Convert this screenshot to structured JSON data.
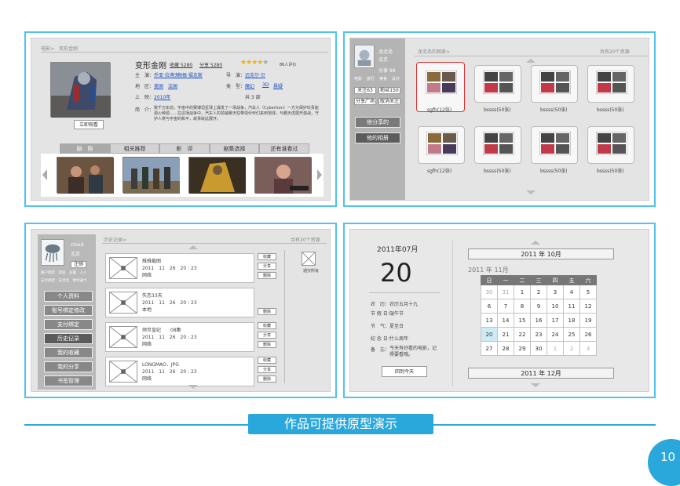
{
  "p1": {
    "breadcrumb": "电影>　变形金刚",
    "title": "变形金刚",
    "collect": "收藏 5280",
    "share": "分享 5280",
    "rating": "86人评价",
    "director_label": "主　演：",
    "director": "乔亚·拉博夫",
    "director2": "梅根·福克斯",
    "guide_label": "导　演：",
    "guide": "迈克尔·贝",
    "region_label": "地　区：",
    "region1": "美国",
    "region2": "法国",
    "type_label": "类　型：",
    "type1": "魔幻",
    "type2": "3D",
    "type3": "悬疑",
    "year_label": "上　映：",
    "year": "2010年",
    "episodes": "共 3 部",
    "summary_label": "简　介：",
    "summary": "数千万年前，宇宙中的赛博坦星球上爆发了一场战争，汽车人（Cybertron）一方为保护珍贵能源火种源……在这场战争中，汽车人的领袖擎天柱带领伙伴们来到地球，与霸天虎展开激战，守护人类与宇宙的和平，故事就此展开。",
    "watch_btn": "立即观看",
    "tabs": [
      "剧　照",
      "相关推荐",
      "影　评",
      "剧集选择",
      "还有谁看过"
    ]
  },
  "p2": {
    "name": "龙北岛",
    "city": "北京",
    "meta": "分享 98",
    "tags": [
      "电影",
      "旅行",
      "美食",
      "设计"
    ],
    "follow": "关注63",
    "fans": "粉丝150",
    "share_album": "分享广场",
    "cancel": "取消关注",
    "btn1": "他分享的",
    "btn2": "他的相册",
    "breadcrumb": "龙北岛的相册>",
    "count": "共有20个资源",
    "albums": [
      "sgfh(12张)",
      "bssss(50张)",
      "bssss(50张)",
      "bssss(50张)",
      "sgfh(12张)",
      "bssss(50张)",
      "bssss(50张)",
      "bssss(50张)"
    ]
  },
  "p3": {
    "name": "cloud",
    "city": "北京",
    "logout": "注销",
    "links": "账户绑定：新浪　豆瓣　人人",
    "links2": "支付绑定：支付宝　财付通卡",
    "breadcrumb": "历史记录>",
    "count": "共有20个资源",
    "menu": [
      "个人资料",
      "账号绑定修改",
      "支付绑定",
      "历史记录",
      "我的收藏",
      "我的分享",
      "书签管理"
    ],
    "items": [
      {
        "title": "蛛蛛截图",
        "date": "2011　11　26　20 : 23",
        "src": "网络",
        "btns": [
          "收藏",
          "分享",
          "删除"
        ]
      },
      {
        "title": "失恋33天",
        "date": "2011　11　26　20 : 23",
        "src": "本地",
        "btns": [
          "删除"
        ]
      },
      {
        "title": "倾世皇妃　　08集",
        "date": "2011　11　26　20 : 23",
        "src": "网络",
        "btns": [
          "收藏",
          "分享",
          "删除"
        ]
      },
      {
        "title": "LONGMAO．JPG",
        "date": "2011　11　26　20 : 23",
        "src": "网络",
        "btns": [
          "收藏",
          "分享",
          "删除"
        ]
      }
    ],
    "empty": "通交所有"
  },
  "p4": {
    "ym": "2011年07月",
    "day": "20",
    "lunar_label": "农　历：",
    "lunar": "农历五月十九",
    "fest_label": "节 假 日：",
    "fest": "端午节",
    "term_label": "节　气：",
    "term": "夏至日",
    "memo_label": "纪 念 日：",
    "memo": "什么周年",
    "note_label": "备　忘：",
    "note": "今天有好看的电影，记得要看哦。",
    "back_btn": "回到今天",
    "prev_month": "2011 年 10月",
    "cur_month": "2011 年 11月",
    "next_month": "2011 年 12月",
    "weekdays": [
      "日",
      "一",
      "二",
      "三",
      "四",
      "五",
      "六"
    ],
    "days": [
      [
        "30",
        "31",
        "1",
        "2",
        "3",
        "4",
        "5"
      ],
      [
        "6",
        "7",
        "8",
        "9",
        "10",
        "11",
        "12"
      ],
      [
        "13",
        "14",
        "15",
        "16",
        "17",
        "18",
        "19"
      ],
      [
        "20",
        "21",
        "22",
        "23",
        "24",
        "25",
        "26"
      ],
      [
        "27",
        "28",
        "29",
        "30",
        "1",
        "2",
        "3"
      ]
    ]
  },
  "footer": {
    "banner": "作品可提供原型演示",
    "page": "10"
  },
  "colors": {
    "accent": "#4fc3ec",
    "banner": "#2aa8dc"
  }
}
